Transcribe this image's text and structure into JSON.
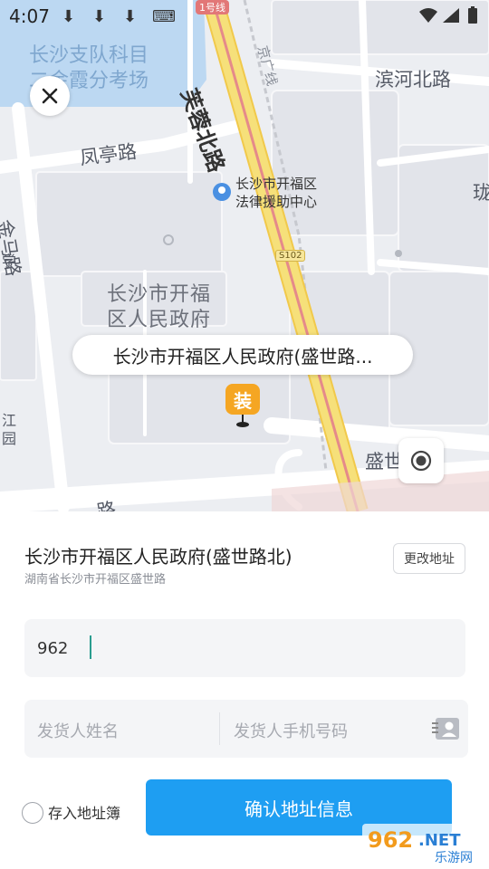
{
  "status_bar": {
    "time": "4:07"
  },
  "map": {
    "labels": {
      "water_area": "长沙支队科目\n二金霞分考场",
      "fengting_road": "凤亭路",
      "furong_north": "芙蓉北路",
      "metro_line": "1号线",
      "jingguang": "京广线",
      "binhe_north": "滨河北路",
      "legal_aid": "长沙市开福区\n法律援助中心",
      "jinma_road": "金马路",
      "gov_building": "长沙市开福\n区人民政府",
      "shengshi_road": "盛世路",
      "s102": "S102",
      "edge_xue": "学",
      "edge_jiang": "江\n园",
      "edge_lu": "路",
      "edge_lu2": "珑"
    },
    "callout": "长沙市开福区人民政府(盛世路...",
    "pin_label": "装"
  },
  "sheet": {
    "address_title": "长沙市开福区人民政府(盛世路北)",
    "address_sub": "湖南省长沙市开福区盛世路",
    "change_button": "更改地址",
    "detail_value": "962",
    "name_placeholder": "发货人姓名",
    "phone_placeholder": "发货人手机号码",
    "save_label": "存入地址簿",
    "confirm_button": "确认地址信息"
  },
  "watermark": {
    "text1": "962",
    "text2": ".NET",
    "text3": "乐游网"
  },
  "colors": {
    "primary": "#1e9ef2",
    "pin": "#f5a623",
    "road_major": "#f6e07a",
    "water": "#bcd8f2"
  }
}
